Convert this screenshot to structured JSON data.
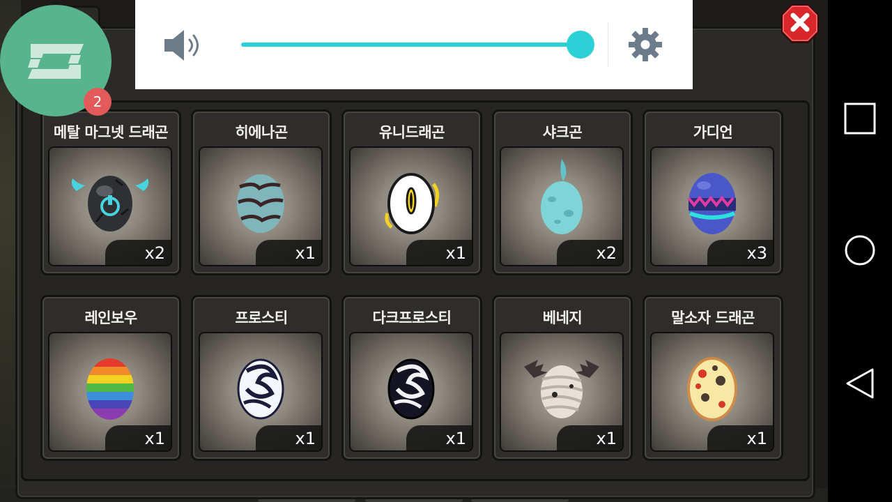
{
  "volume": {
    "level_percent": 100,
    "accent_color": "#2bd1d6",
    "icons": {
      "speaker": "speaker-volume-icon",
      "settings": "gear-icon"
    }
  },
  "app_bubble": {
    "icon": "bracket-logo-icon",
    "notification_count": "2",
    "color": "#58b48d"
  },
  "close_button": {
    "icon": "close-x-icon",
    "color": "#d9262b"
  },
  "inventory": {
    "slots": [
      {
        "name": "메탈 마그넷 드래곤",
        "count": "x2",
        "egg": "metal-magnet-dragon-egg-icon"
      },
      {
        "name": "히에나곤",
        "count": "x1",
        "egg": "hyenagon-egg-icon"
      },
      {
        "name": "유니드래곤",
        "count": "x1",
        "egg": "uni-dragon-egg-icon"
      },
      {
        "name": "샤크곤",
        "count": "x2",
        "egg": "sharkgon-egg-icon"
      },
      {
        "name": "가디언",
        "count": "x3",
        "egg": "guardian-egg-icon"
      },
      {
        "name": "레인보우",
        "count": "x1",
        "egg": "rainbow-egg-icon"
      },
      {
        "name": "프로스티",
        "count": "x1",
        "egg": "frosty-egg-icon"
      },
      {
        "name": "다크프로스티",
        "count": "x1",
        "egg": "dark-frosty-egg-icon"
      },
      {
        "name": "베네지",
        "count": "x1",
        "egg": "benezi-egg-icon"
      },
      {
        "name": "말소자 드래곤",
        "count": "x1",
        "egg": "malsoja-dragon-egg-icon"
      }
    ]
  },
  "navigation": {
    "recent_apps": "square-recents-icon",
    "home": "circle-home-icon",
    "back": "triangle-back-icon"
  }
}
